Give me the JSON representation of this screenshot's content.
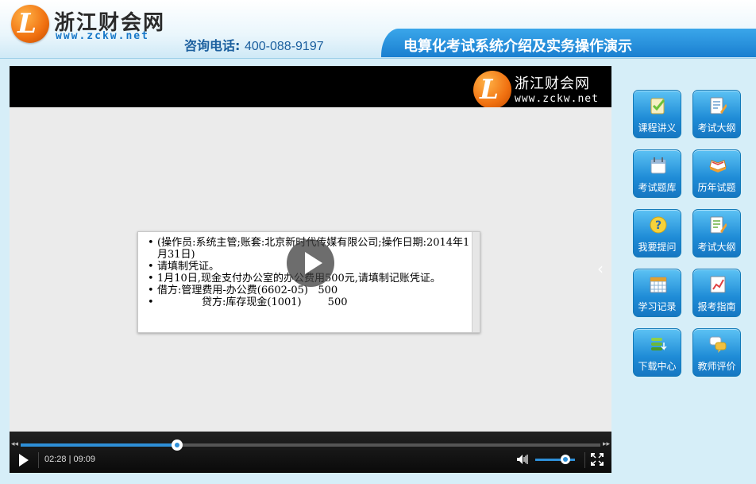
{
  "header": {
    "logo_name": "浙江财会网",
    "logo_url": "www.zckw.net",
    "hotline_label": "咨询电话:",
    "hotline_number": "400-088-9197",
    "page_title": "电算化考试系统介绍及实务操作演示"
  },
  "player": {
    "watermark_name": "浙江财会网",
    "watermark_url": "www.zckw.net",
    "current_time": "02:28",
    "duration": "09:09",
    "time_separator": "|",
    "progress": 0.27,
    "volume": 0.75,
    "slide_lines": [
      "(操作员:系统主管;账套:北京新时代传媒有限公司;操作日期:2014年1月31日)",
      "请填制凭证。",
      "1月10日,现金支付办公室的办公费用500元,请填制记账凭证。",
      "借方:管理费用-办公费(6602-05) 500",
      "贷方:库存现金(1001) 500"
    ],
    "debit_line": {
      "label": "借方:管理费用-办公费(6602-05)",
      "amount": "500"
    },
    "credit_line": {
      "label": "贷方:库存现金(1001)",
      "amount": "500"
    }
  },
  "menu": [
    {
      "label": "课程讲义",
      "icon": "notebook-check-icon"
    },
    {
      "label": "考试大纲",
      "icon": "document-pencil-icon"
    },
    {
      "label": "考试题库",
      "icon": "calendar-icon"
    },
    {
      "label": "历年试题",
      "icon": "open-book-icon"
    },
    {
      "label": "我要提问",
      "icon": "question-icon"
    },
    {
      "label": "考试大纲",
      "icon": "document-pencil-icon"
    },
    {
      "label": "学习记录",
      "icon": "grid-calendar-icon"
    },
    {
      "label": "报考指南",
      "icon": "chart-document-icon"
    },
    {
      "label": "下载中心",
      "icon": "download-stack-icon"
    },
    {
      "label": "教师评价",
      "icon": "chat-bubbles-icon"
    }
  ],
  "colors": {
    "accent": "#1e8bd6",
    "brand_orange": "#f07010",
    "stage_bg": "#ebebeb"
  }
}
